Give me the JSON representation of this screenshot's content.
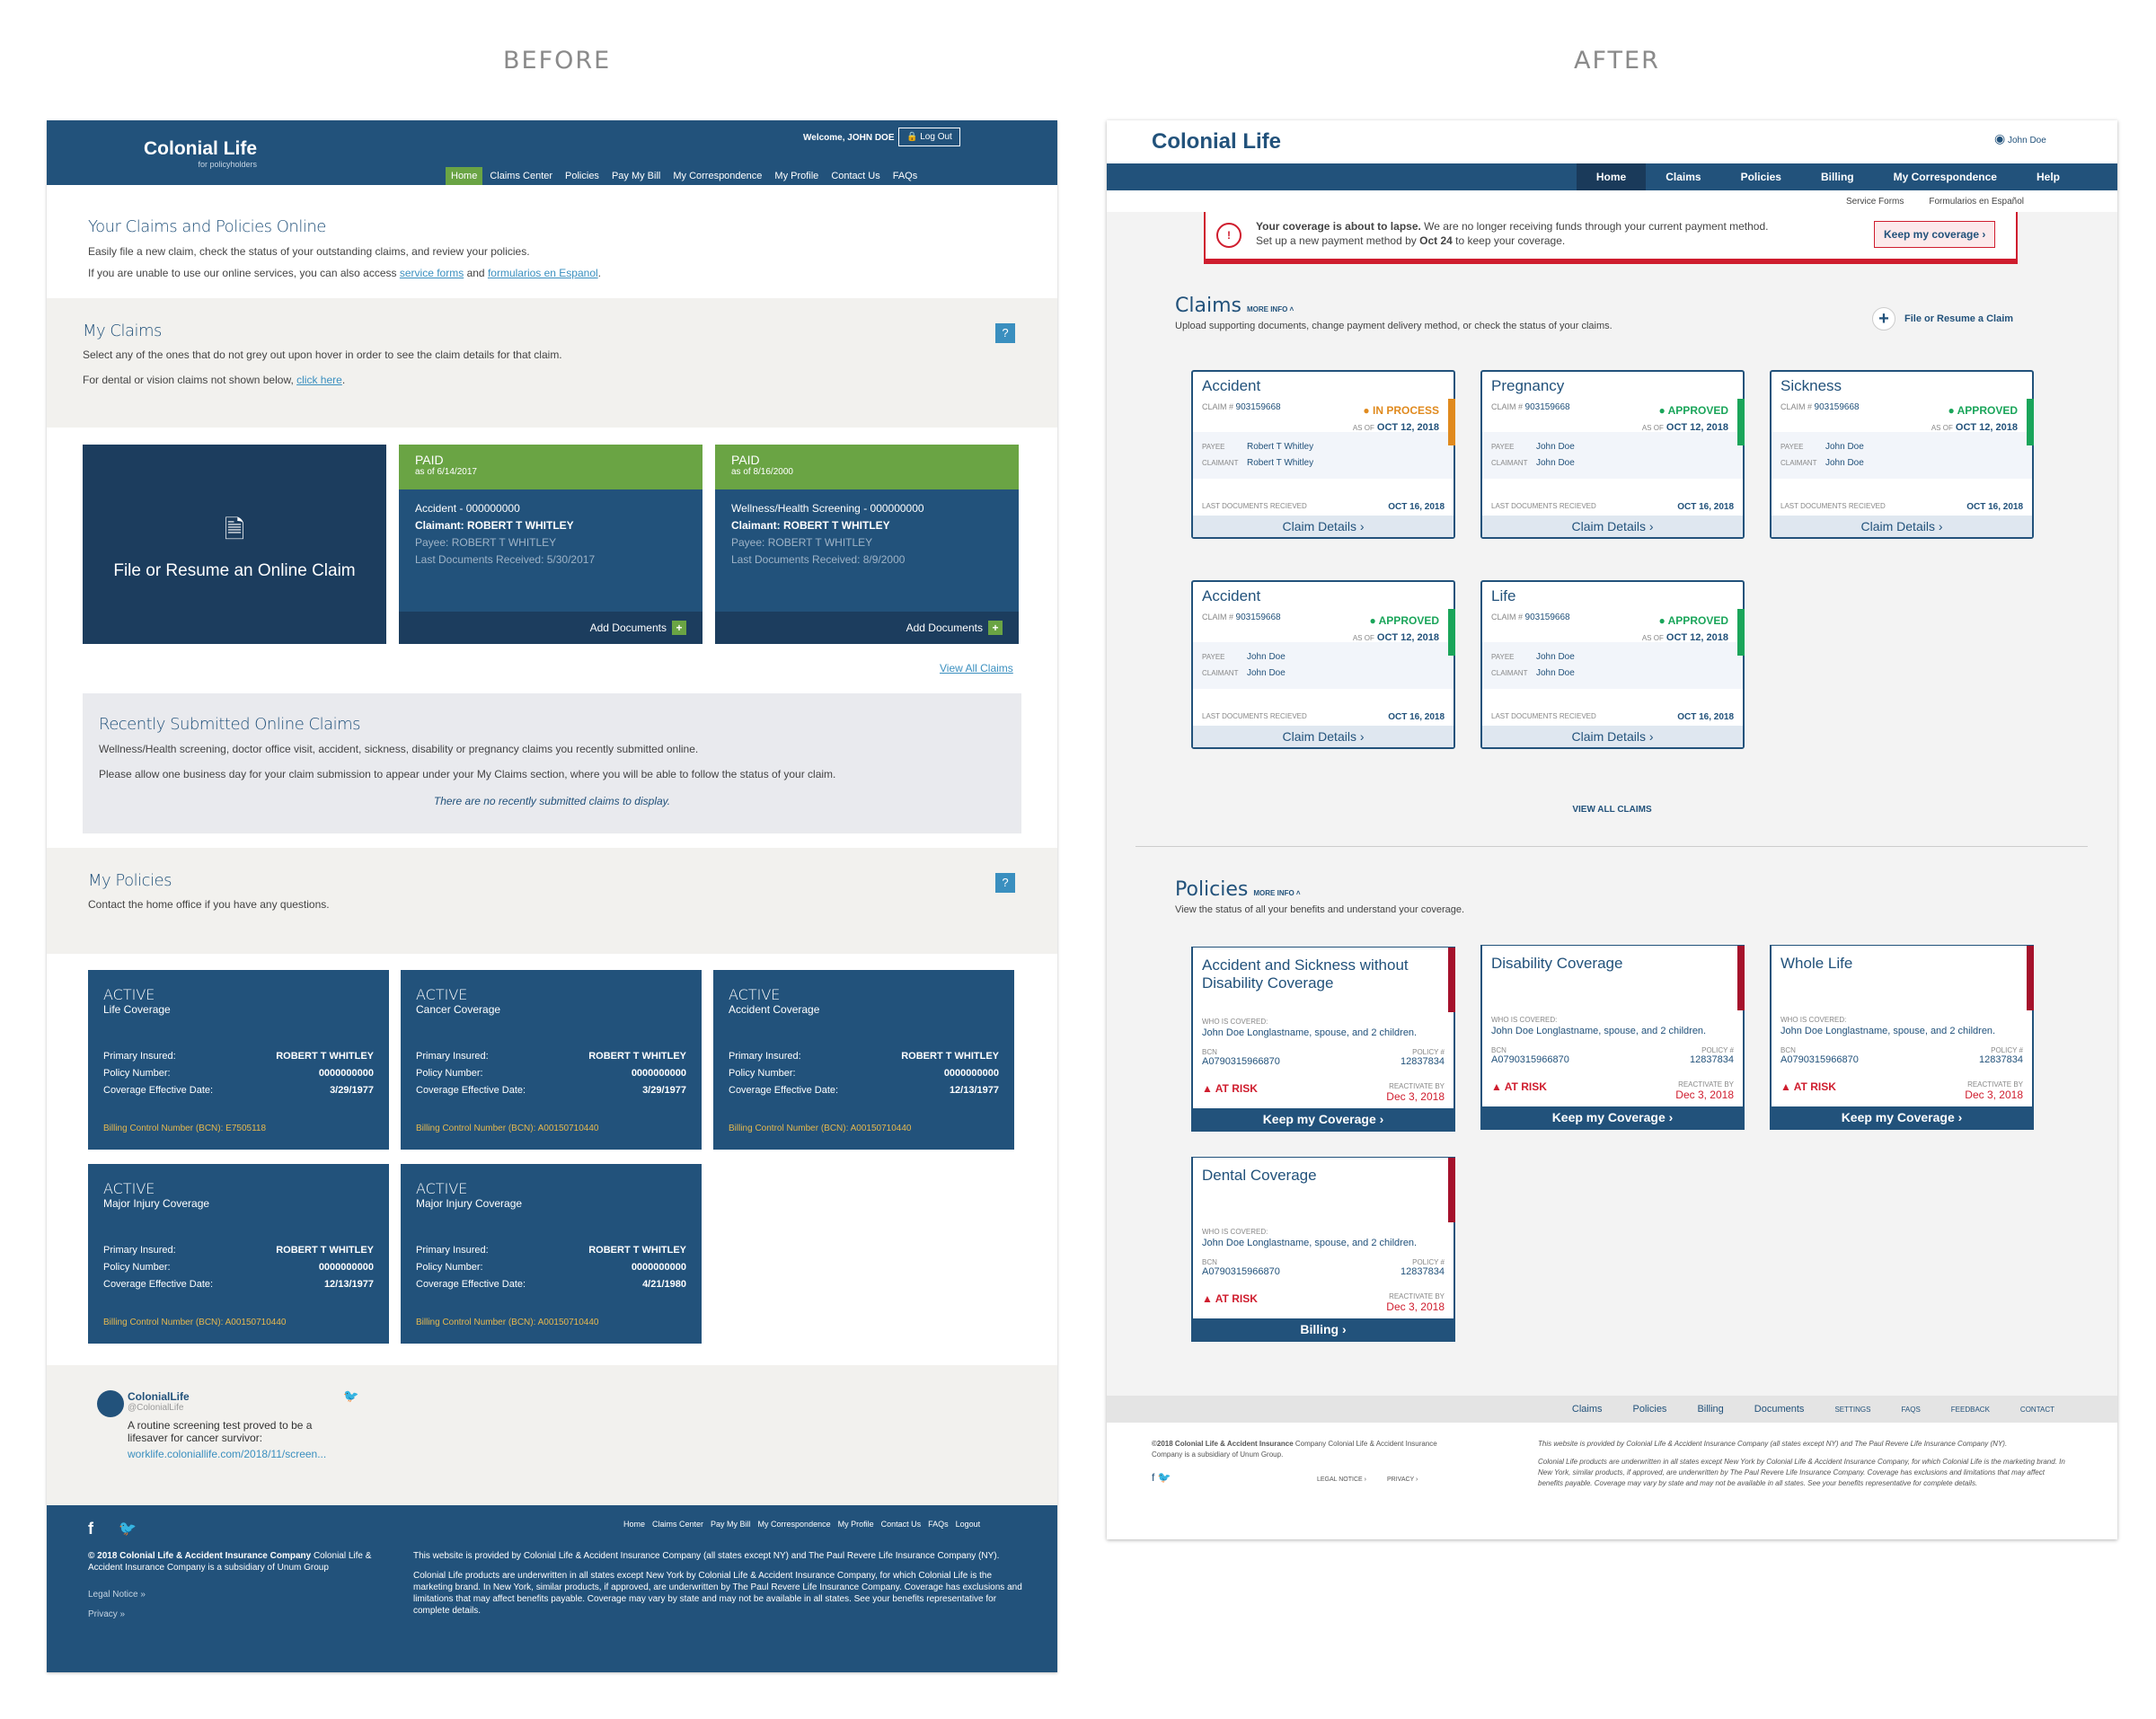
{
  "labels": {
    "before": "BEFORE",
    "after": "AFTER"
  },
  "before": {
    "logo": "Colonial Life",
    "logo_sub": "for policyholders",
    "welcome": "Welcome, JOHN DOE",
    "logout": "Log Out",
    "menu": [
      "Home",
      "Claims Center",
      "Policies",
      "Pay My Bill",
      "My Correspondence",
      "My Profile",
      "Contact Us",
      "FAQs"
    ],
    "hero_title": "Your Claims and Policies Online",
    "hero_p1": "Easily file a new claim, check the status of your outstanding claims, and review your policies.",
    "hero_p2a": "If you are unable to use our online services, you can also access",
    "hero_link1": "service forms",
    "hero_and": "and",
    "hero_link2": "formularios en Espanol",
    "claims_title": "My Claims",
    "claims_p1": "Select any of the ones that do not grey out upon hover in order to see the claim details for that claim.",
    "claims_p2": "For dental or vision claims not shown below,",
    "claims_link": "click here",
    "file_claim": "File or Resume an Online Claim",
    "claims": [
      {
        "status": "PAID",
        "asof": "as of 6/14/2017",
        "type": "Accident - 000000000",
        "claimant": "Claimant: ROBERT T WHITLEY",
        "payee": "Payee: ROBERT T WHITLEY",
        "last": "Last Documents Received: 5/30/2017",
        "add": "Add Documents"
      },
      {
        "status": "PAID",
        "asof": "as of 8/16/2000",
        "type": "Wellness/Health Screening - 000000000",
        "claimant": "Claimant: ROBERT T WHITLEY",
        "payee": "Payee: ROBERT T WHITLEY",
        "last": "Last Documents Received: 8/9/2000",
        "add": "Add Documents"
      }
    ],
    "view_all": "View All Claims",
    "recent_title": "Recently Submitted Online Claims",
    "recent_p1": "Wellness/Health screening, doctor office visit, accident, sickness, disability or pregnancy claims you recently submitted online.",
    "recent_p2": "Please allow one business day for your claim submission to appear under your My Claims section, where you will be able to follow the status of your claim.",
    "recent_empty": "There are no recently submitted claims to display.",
    "policies_title": "My Policies",
    "policies_p": "Contact the home office if you have any questions.",
    "pol_labels": {
      "insured": "Primary Insured:",
      "number": "Policy Number:",
      "eff": "Coverage Effective Date:"
    },
    "policies": [
      {
        "status": "ACTIVE",
        "name": "Life Coverage",
        "insured": "ROBERT T WHITLEY",
        "number": "0000000000",
        "date": "3/29/1977",
        "bcn": "Billing Control Number (BCN): E7505118"
      },
      {
        "status": "ACTIVE",
        "name": "Cancer Coverage",
        "insured": "ROBERT T WHITLEY",
        "number": "0000000000",
        "date": "3/29/1977",
        "bcn": "Billing Control Number (BCN): A00150710440"
      },
      {
        "status": "ACTIVE",
        "name": "Accident Coverage",
        "insured": "ROBERT T WHITLEY",
        "number": "0000000000",
        "date": "12/13/1977",
        "bcn": "Billing Control Number (BCN): A00150710440"
      },
      {
        "status": "ACTIVE",
        "name": "Major Injury Coverage",
        "insured": "ROBERT T WHITLEY",
        "number": "0000000000",
        "date": "12/13/1977",
        "bcn": "Billing Control Number (BCN): A00150710440"
      },
      {
        "status": "ACTIVE",
        "name": "Major Injury Coverage",
        "insured": "ROBERT T WHITLEY",
        "number": "0000000000",
        "date": "4/21/1980",
        "bcn": "Billing Control Number (BCN): A00150710440"
      }
    ],
    "tweet_name": "ColonialLife",
    "tweet_handle": "@ColonialLife",
    "tweet_text": "A routine screening test proved to be a lifesaver for cancer survivor:",
    "tweet_link": "worklife.coloniallife.com/2018/11/screen...",
    "foot_menu": [
      "Home",
      "Claims Center",
      "Pay My Bill",
      "My Correspondence",
      "My Profile",
      "Contact Us",
      "FAQs",
      "Logout"
    ],
    "foot_copy_b": "© 2018 Colonial Life & Accident Insurance Company",
    "foot_copy": "Colonial Life & Accident Insurance Company is a subsidiary of Unum Group",
    "legal": "Legal Notice »",
    "privacy": "Privacy »",
    "foot_p1": "This website is provided by Colonial Life & Accident Insurance Company (all states except NY) and The Paul Revere Life Insurance Company (NY).",
    "foot_p2": "Colonial Life products are underwritten in all states except New York by Colonial Life & Accident Insurance Company, for which Colonial Life is the marketing brand. In New York, similar products, if approved, are underwritten by The Paul Revere Life Insurance Company. Coverage has exclusions and limitations that may affect benefits payable. Coverage may vary by state and may not be available in all states. See your benefits representative for complete details."
  },
  "after": {
    "logo": "Colonial Life",
    "user": "John Doe",
    "nav": [
      "Home",
      "Claims",
      "Policies",
      "Billing",
      "My Correspondence",
      "Help"
    ],
    "sub": [
      "Service Forms",
      "Formularios en Español"
    ],
    "alert_b": "Your coverage is about to lapse.",
    "alert_t": " We are no longer receiving funds through your current payment method.",
    "alert_t2": "Set up a new payment method by ",
    "alert_date": "Oct 24",
    "alert_t3": " to keep your coverage.",
    "alert_btn": "Keep my coverage ›",
    "claims_title": "Claims",
    "more": "MORE INFO ˄",
    "claims_sub": "Upload supporting documents, change payment delivery method, or check the status of your claims.",
    "file": "File or Resume a Claim",
    "lbl": {
      "claimno": "CLAIM #",
      "asof": "AS OF",
      "payee": "PAYEE",
      "claimant": "CLAIMANT",
      "last": "LAST DOCUMENTS RECIEVED",
      "details": "Claim Details ›"
    },
    "claims": [
      {
        "title": "Accident",
        "no": "903159668",
        "status": "IN PROCESS",
        "date": "OCT 12, 2018",
        "payee": "Robert T Whitley",
        "claimant": "Robert T Whitley",
        "last": "OCT 16, 2018",
        "color": "#e08a1e"
      },
      {
        "title": "Pregnancy",
        "no": "903159668",
        "status": "APPROVED",
        "date": "OCT 12, 2018",
        "payee": "John Doe",
        "claimant": "John Doe",
        "last": "OCT 16, 2018",
        "color": "#1aa55a"
      },
      {
        "title": "Sickness",
        "no": "903159668",
        "status": "APPROVED",
        "date": "OCT 12, 2018",
        "payee": "John Doe",
        "claimant": "John Doe",
        "last": "OCT 16, 2018",
        "color": "#1aa55a"
      },
      {
        "title": "Accident",
        "no": "903159668",
        "status": "APPROVED",
        "date": "OCT 12, 2018",
        "payee": "John Doe",
        "claimant": "John Doe",
        "last": "OCT 16, 2018",
        "color": "#1aa55a"
      },
      {
        "title": "Life",
        "no": "903159668",
        "status": "APPROVED",
        "date": "OCT 12, 2018",
        "payee": "John Doe",
        "claimant": "John Doe",
        "last": "OCT 16, 2018",
        "color": "#1aa55a"
      }
    ],
    "view_all": "VIEW ALL CLAIMS",
    "pol_title": "Policies",
    "pol_sub": "View the status of all your benefits and understand your coverage.",
    "plbl": {
      "who": "WHO IS COVERED:",
      "bcn": "BCN",
      "policy": "POLICY #",
      "reactivate": "REACTIVATE BY",
      "risk": "AT RISK"
    },
    "policies": [
      {
        "title": "Accident and Sickness without Disability Coverage",
        "who": "John Doe Longlastname, spouse, and 2 children.",
        "bcn": "A0790315966870",
        "policy": "12837834",
        "date": "Dec 3, 2018",
        "cta": "Keep my Coverage ›"
      },
      {
        "title": "Disability Coverage",
        "who": "John Doe Longlastname, spouse, and 2 children.",
        "bcn": "A0790315966870",
        "policy": "12837834",
        "date": "Dec 3, 2018",
        "cta": "Keep my Coverage ›"
      },
      {
        "title": "Whole Life",
        "who": "John Doe Longlastname, spouse, and 2 children.",
        "bcn": "A0790315966870",
        "policy": "12837834",
        "date": "Dec 3, 2018",
        "cta": "Keep my Coverage ›"
      },
      {
        "title": "Dental Coverage",
        "who": "John Doe Longlastname, spouse, and 2 children.",
        "bcn": "A0790315966870",
        "policy": "12837834",
        "date": "Dec 3, 2018",
        "cta": "Billing ›"
      }
    ],
    "footer_main": [
      "Claims",
      "Policies",
      "Billing",
      "Documents"
    ],
    "footer_small": [
      "SETTINGS",
      "FAQS",
      "FEEDBACK",
      "CONTACT"
    ],
    "copy_b": "©2018 Colonial Life & Accident Insurance",
    "copy": " Company Colonial Life & Accident Insurance Company is a subsidiary of Unum Group.",
    "legal": "LEGAL NOTICE ›",
    "privacy": "PRIVACY ›",
    "legal_p1": "This website is provided by Colonial Life & Accident Insurance Company (all states except NY) and The Paul Revere Life Insurance Company (NY).",
    "legal_p2": "Colonial Life products are underwritten in all states except New York by Colonial Life & Accident Insurance Company, for which Colonial Life is the marketing brand. In New York, similar products, if approved, are underwritten by The Paul Revere Life Insurance Company. Coverage has exclusions and limitations that may affect benefits payable. Coverage may vary by state and may not be available in all states. See your benefits representative for complete details."
  }
}
